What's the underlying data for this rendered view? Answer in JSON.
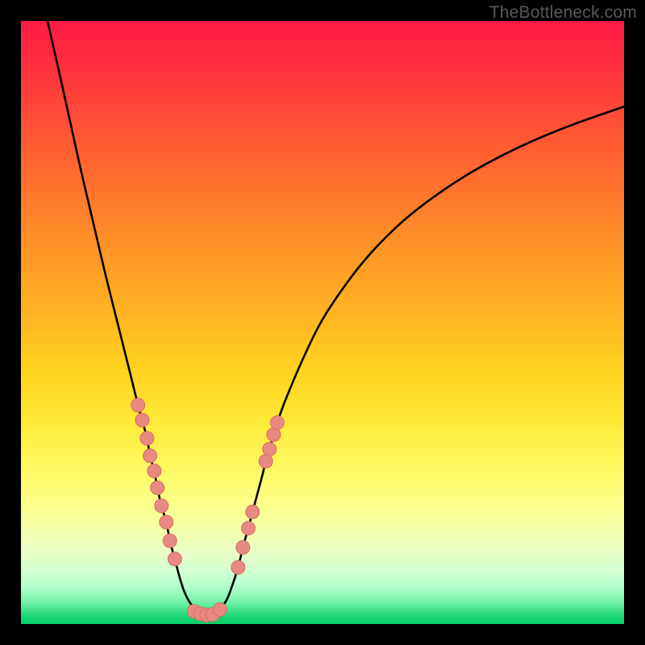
{
  "watermark": {
    "text": "TheBottleneck.com"
  },
  "colors": {
    "frame": "#000000",
    "curve": "#000000",
    "dot_fill": "#e98a82",
    "dot_stroke": "#d66e66"
  },
  "chart_data": {
    "type": "line",
    "title": "",
    "xlabel": "",
    "ylabel": "",
    "xlim": [
      0,
      100
    ],
    "ylim": [
      0,
      100
    ],
    "grid": false,
    "legend": false,
    "note": "No axis ticks or numeric labels are visible; values estimated from pixel positions (origin bottom-left, 0–100 each axis).",
    "series": [
      {
        "name": "left-curve",
        "values": [
          {
            "x": 4.4,
            "y": 100.0
          },
          {
            "x": 6.0,
            "y": 93.0
          },
          {
            "x": 8.0,
            "y": 84.0
          },
          {
            "x": 10.0,
            "y": 75.0
          },
          {
            "x": 12.0,
            "y": 66.5
          },
          {
            "x": 14.0,
            "y": 58.0
          },
          {
            "x": 16.0,
            "y": 50.0
          },
          {
            "x": 18.0,
            "y": 42.0
          },
          {
            "x": 19.4,
            "y": 36.3
          },
          {
            "x": 20.1,
            "y": 33.8
          },
          {
            "x": 20.9,
            "y": 30.8
          },
          {
            "x": 21.4,
            "y": 27.9
          },
          {
            "x": 22.1,
            "y": 25.4
          },
          {
            "x": 22.6,
            "y": 22.6
          },
          {
            "x": 23.3,
            "y": 19.6
          },
          {
            "x": 24.1,
            "y": 16.9
          },
          {
            "x": 24.7,
            "y": 13.8
          },
          {
            "x": 25.5,
            "y": 10.8
          },
          {
            "x": 26.3,
            "y": 7.8
          },
          {
            "x": 27.0,
            "y": 5.6
          },
          {
            "x": 27.8,
            "y": 3.9
          },
          {
            "x": 28.9,
            "y": 2.4
          },
          {
            "x": 30.0,
            "y": 1.7
          },
          {
            "x": 31.0,
            "y": 1.5
          }
        ]
      },
      {
        "name": "right-curve",
        "values": [
          {
            "x": 31.0,
            "y": 1.5
          },
          {
            "x": 31.8,
            "y": 1.6
          },
          {
            "x": 33.0,
            "y": 2.5
          },
          {
            "x": 34.1,
            "y": 4.0
          },
          {
            "x": 34.9,
            "y": 6.0
          },
          {
            "x": 36.0,
            "y": 9.4
          },
          {
            "x": 36.8,
            "y": 12.7
          },
          {
            "x": 37.7,
            "y": 15.9
          },
          {
            "x": 38.4,
            "y": 18.6
          },
          {
            "x": 39.8,
            "y": 23.8
          },
          {
            "x": 40.6,
            "y": 27.0
          },
          {
            "x": 41.2,
            "y": 29.0
          },
          {
            "x": 41.9,
            "y": 31.4
          },
          {
            "x": 42.5,
            "y": 33.4
          },
          {
            "x": 44.0,
            "y": 37.5
          },
          {
            "x": 47.0,
            "y": 44.5
          },
          {
            "x": 50.0,
            "y": 50.5
          },
          {
            "x": 54.0,
            "y": 56.5
          },
          {
            "x": 58.0,
            "y": 61.5
          },
          {
            "x": 63.0,
            "y": 66.5
          },
          {
            "x": 68.0,
            "y": 70.5
          },
          {
            "x": 74.0,
            "y": 74.5
          },
          {
            "x": 80.0,
            "y": 77.8
          },
          {
            "x": 86.0,
            "y": 80.6
          },
          {
            "x": 92.0,
            "y": 83.0
          },
          {
            "x": 100.0,
            "y": 85.8
          }
        ]
      }
    ],
    "dots": [
      {
        "x": 19.4,
        "y": 36.3
      },
      {
        "x": 20.1,
        "y": 33.8
      },
      {
        "x": 20.9,
        "y": 30.8
      },
      {
        "x": 21.4,
        "y": 27.9
      },
      {
        "x": 22.1,
        "y": 25.4
      },
      {
        "x": 22.6,
        "y": 22.6
      },
      {
        "x": 23.3,
        "y": 19.6
      },
      {
        "x": 24.1,
        "y": 16.9
      },
      {
        "x": 24.7,
        "y": 13.8
      },
      {
        "x": 25.5,
        "y": 10.8
      },
      {
        "x": 28.7,
        "y": 2.1
      },
      {
        "x": 29.8,
        "y": 1.7
      },
      {
        "x": 30.8,
        "y": 1.5
      },
      {
        "x": 31.8,
        "y": 1.6
      },
      {
        "x": 33.0,
        "y": 2.4
      },
      {
        "x": 36.0,
        "y": 9.4
      },
      {
        "x": 36.8,
        "y": 12.7
      },
      {
        "x": 37.7,
        "y": 15.9
      },
      {
        "x": 38.4,
        "y": 18.6
      },
      {
        "x": 40.6,
        "y": 27.0
      },
      {
        "x": 41.2,
        "y": 29.0
      },
      {
        "x": 41.9,
        "y": 31.4
      },
      {
        "x": 42.5,
        "y": 33.4
      }
    ]
  }
}
